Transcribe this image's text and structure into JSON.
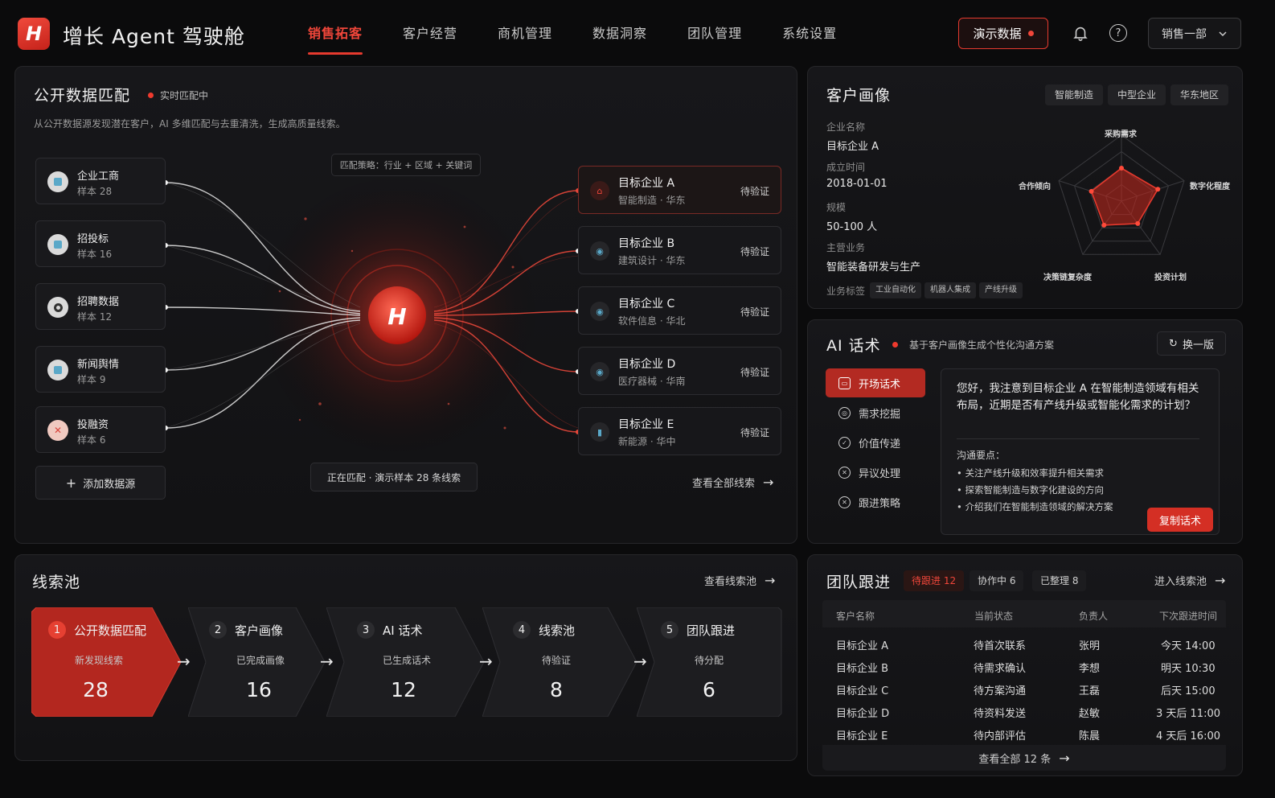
{
  "header": {
    "logo": "H",
    "title": "增长 Agent 驾驶舱",
    "nav": [
      "销售拓客",
      "客户经营",
      "商机管理",
      "数据洞察",
      "团队管理",
      "系统设置"
    ],
    "demo_label": "演示数据",
    "dept": "销售一部",
    "accent": "#e63a2e"
  },
  "match": {
    "title": "公开数据匹配",
    "status": "实时匹配中",
    "desc": "从公开数据源发现潜在客户，AI 多维匹配与去重清洗，生成高质量线索。",
    "strategy": "匹配策略：行业 + 区域 + 关键词",
    "sources": [
      {
        "name": "企业工商",
        "count": "样本 28",
        "icon": "building-icon"
      },
      {
        "name": "招投标",
        "count": "样本 16",
        "icon": "bid-icon"
      },
      {
        "name": "招聘数据",
        "count": "样本 12",
        "icon": "recruit-icon"
      },
      {
        "name": "新闻舆情",
        "count": "样本 9",
        "icon": "news-icon"
      },
      {
        "name": "投融资",
        "count": "样本 6",
        "icon": "finance-icon"
      }
    ],
    "add_source": "添加数据源",
    "progress": "正在匹配 · 演示样本 28 条线索",
    "targets": [
      {
        "name": "目标企业 A",
        "meta": "智能制造 · 华东",
        "status": "待验证"
      },
      {
        "name": "目标企业 B",
        "meta": "建筑设计 · 华东",
        "status": "待验证"
      },
      {
        "name": "目标企业 C",
        "meta": "软件信息 · 华北",
        "status": "待验证"
      },
      {
        "name": "目标企业 D",
        "meta": "医疗器械 · 华南",
        "status": "待验证"
      },
      {
        "name": "目标企业 E",
        "meta": "新能源 · 华中",
        "status": "待验证"
      }
    ],
    "view_all": "查看全部线索"
  },
  "profile": {
    "title": "客户画像",
    "tags": [
      "智能制造",
      "中型企业",
      "华东地区"
    ],
    "fields": [
      {
        "label": "企业名称",
        "value": "目标企业 A"
      },
      {
        "label": "成立时间",
        "value": "2018-01-01"
      },
      {
        "label": "规模",
        "value": "50-100 人"
      },
      {
        "label": "主营业务",
        "value": "智能装备研发与生产"
      }
    ],
    "biz_tags_label": "业务标签",
    "biz_tags": [
      "工业自动化",
      "机器人集成",
      "产线升级"
    ],
    "radar_axes": [
      "采购需求",
      "数字化程度",
      "投资计划",
      "决策链复杂度",
      "合作倾向"
    ],
    "radar_values": [
      0.5,
      0.58,
      0.42,
      0.45,
      0.48
    ]
  },
  "ai": {
    "title": "AI 话术",
    "subtitle": "基于客户画像生成个性化沟通方案",
    "refresh": "换一版",
    "menu": [
      "开场话术",
      "需求挖掘",
      "价值传递",
      "异议处理",
      "跟进策略"
    ],
    "script": "您好，我注意到目标企业 A 在智能制造领域有相关布局，近期是否有产线升级或智能化需求的计划？",
    "points_title": "沟通要点：",
    "points": [
      "关注产线升级和效率提升相关需求",
      "探索智能制造与数字化建设的方向",
      "介绍我们在智能制造领域的解决方案"
    ],
    "copy": "复制话术"
  },
  "pool": {
    "title": "线索池",
    "view": "查看线索池",
    "stages": [
      {
        "num": "1",
        "label": "公开数据匹配",
        "desc": "新发现线索",
        "value": "28"
      },
      {
        "num": "2",
        "label": "客户画像",
        "desc": "已完成画像",
        "value": "16"
      },
      {
        "num": "3",
        "label": "AI 话术",
        "desc": "已生成话术",
        "value": "12"
      },
      {
        "num": "4",
        "label": "线索池",
        "desc": "待验证",
        "value": "8"
      },
      {
        "num": "5",
        "label": "团队跟进",
        "desc": "待分配",
        "value": "6"
      }
    ]
  },
  "team": {
    "title": "团队跟进",
    "tabs": [
      "待跟进 12",
      "协作中 6",
      "已整理 8"
    ],
    "enter": "进入线索池",
    "headers": [
      "客户名称",
      "当前状态",
      "负责人",
      "下次跟进时间"
    ],
    "rows": [
      [
        "目标企业 A",
        "待首次联系",
        "张明",
        "今天 14:00"
      ],
      [
        "目标企业 B",
        "待需求确认",
        "李想",
        "明天 10:30"
      ],
      [
        "目标企业 C",
        "待方案沟通",
        "王磊",
        "后天 15:00"
      ],
      [
        "目标企业 D",
        "待资料发送",
        "赵敏",
        "3 天后 11:00"
      ],
      [
        "目标企业 E",
        "待内部评估",
        "陈晨",
        "4 天后 16:00"
      ]
    ],
    "view_all": "查看全部 12 条"
  }
}
